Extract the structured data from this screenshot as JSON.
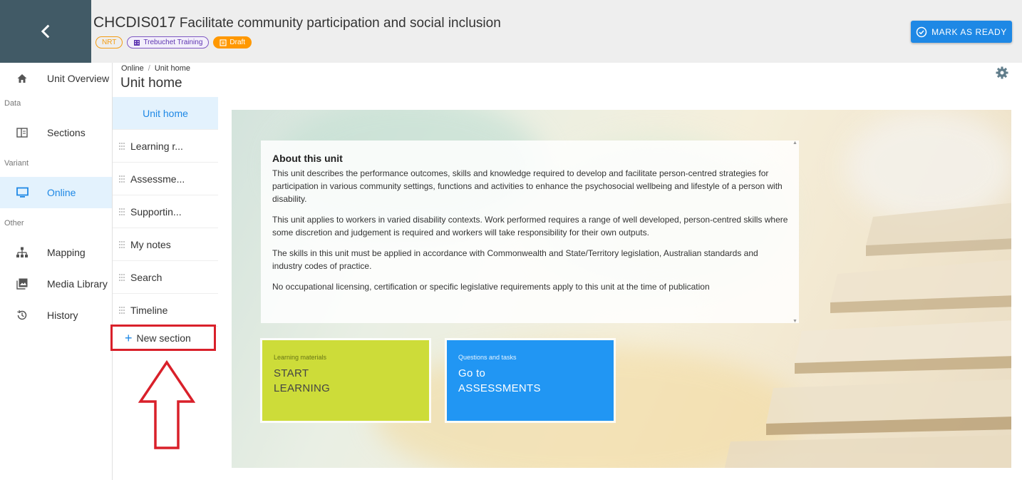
{
  "header": {
    "unit_code": "CHCDIS017",
    "unit_name": "Facilitate community participation and social inclusion",
    "chips": {
      "nrt": "NRT",
      "org": "Trebuchet Training",
      "draft": "Draft"
    },
    "mark_ready": "MARK AS READY",
    "accent": "#1e88e5"
  },
  "left_nav": {
    "overview": "Unit Overview",
    "group_data": "Data",
    "sections": "Sections",
    "group_variant": "Variant",
    "online": "Online",
    "group_other": "Other",
    "mapping": "Mapping",
    "media_library": "Media Library",
    "history": "History"
  },
  "breadcrumb": {
    "root": "Online",
    "separator": "/",
    "current": "Unit home"
  },
  "page_title": "Unit home",
  "sections": {
    "items": [
      "Unit home",
      "Learning r...",
      "Assessme...",
      "Supportin...",
      "My notes",
      "Search",
      "Timeline"
    ],
    "new_section": "New section"
  },
  "about": {
    "title": "About this unit",
    "paragraphs": [
      "This unit describes the performance outcomes, skills and knowledge required to develop and facilitate person-centred strategies for participation in various community settings, functions and activities to enhance the psychosocial wellbeing and lifestyle of a person with disability.",
      "This unit applies to workers in varied disability contexts. Work performed requires a range of well developed, person-centred skills where some discretion and judgement is required and workers will take responsibility for their own outputs.",
      "The skills in this unit must be applied in accordance with Commonwealth and State/Territory legislation, Australian standards and industry codes of practice.",
      "No occupational licensing, certification or specific legislative requirements apply to this unit at the time of publication"
    ]
  },
  "cta": {
    "learning": {
      "small": "Learning materials",
      "line1": "START",
      "line2": "LEARNING",
      "color": "#cddc39"
    },
    "assess": {
      "small": "Questions and tasks",
      "line1": "Go to",
      "line2": "ASSESSMENTS",
      "color": "#2196f3"
    }
  }
}
